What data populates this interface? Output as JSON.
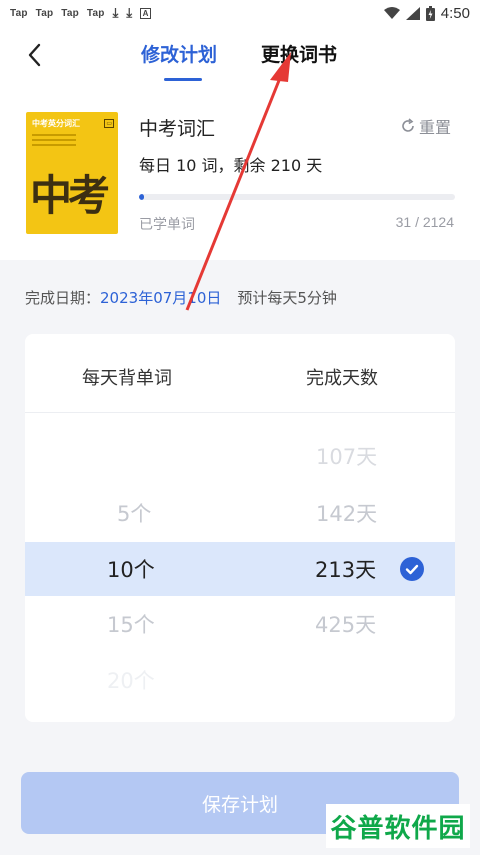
{
  "status_bar": {
    "left_items": [
      "Tap",
      "Tap",
      "Tap",
      "Tap"
    ],
    "time": "4:50"
  },
  "header": {
    "back_icon": "chevron-left-icon",
    "tabs": [
      {
        "label": "修改计划",
        "active": true
      },
      {
        "label": "更换词书",
        "active": false
      }
    ]
  },
  "book": {
    "cover_title": "中考英分词汇",
    "cover_big": "中考",
    "title": "中考词汇",
    "reset_label": "重置",
    "plan_text": "每日 10 词，剩余 210 天",
    "progress_fraction": 0.0146,
    "learned_label": "已学单词",
    "learned_count": "31 / 2124"
  },
  "finish": {
    "label": "完成日期：",
    "date": "2023年07月10日",
    "estimate": "预计每天5分钟"
  },
  "picker": {
    "left_header": "每天背单词",
    "right_header": "完成天数",
    "left_options": [
      "5个",
      "10个",
      "15个",
      "20个"
    ],
    "right_options": [
      "107天",
      "142天",
      "213天",
      "425天"
    ],
    "selected_left": "10个",
    "selected_right": "213天"
  },
  "save_label": "保存计划",
  "watermark": "谷普软件园",
  "colors": {
    "accent": "#2d62d6",
    "selection": "#dbe7fb",
    "save_disabled": "#b4c8f3",
    "annotation_arrow": "#e53935"
  }
}
